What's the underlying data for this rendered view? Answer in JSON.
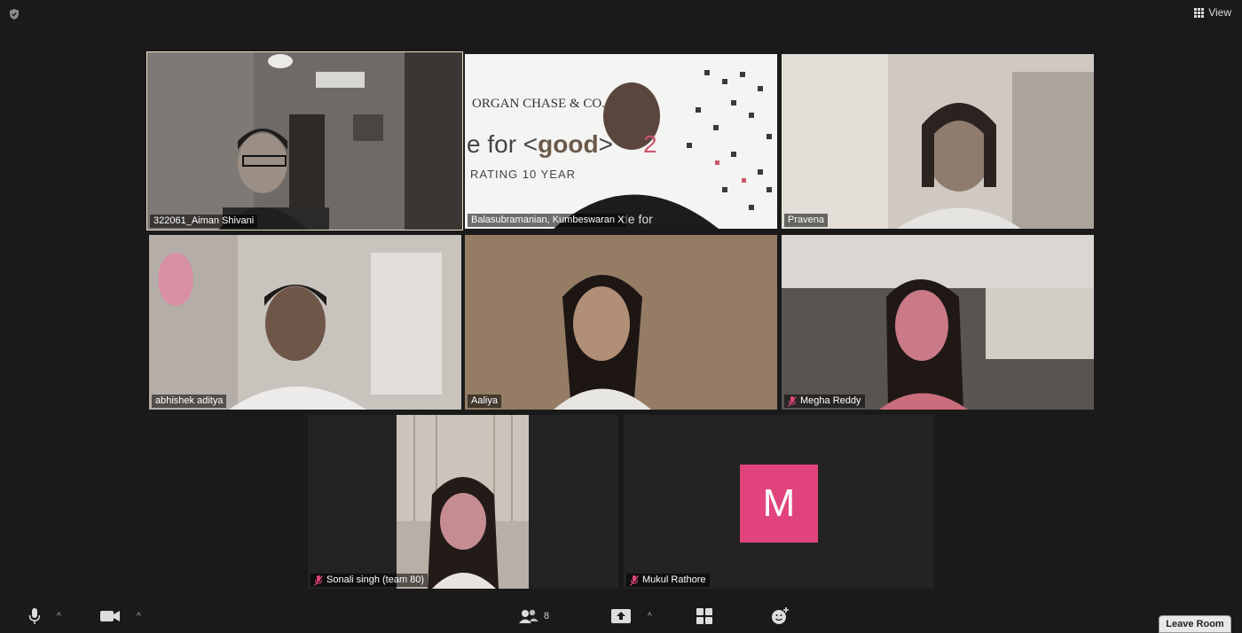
{
  "top": {
    "view_label": "View"
  },
  "participants": [
    {
      "name": "322061_Aiman Shivani",
      "muted": false,
      "active": true
    },
    {
      "name": "Balasubramanian, Kumbeswaran X",
      "muted": false,
      "active": false
    },
    {
      "name": "Pravena",
      "muted": false,
      "active": false
    },
    {
      "name": "abhishek aditya",
      "muted": false,
      "active": false
    },
    {
      "name": "Aaliya",
      "muted": false,
      "active": false
    },
    {
      "name": "Megha Reddy",
      "muted": true,
      "active": false
    },
    {
      "name": "Sonali singh (team 80)",
      "muted": true,
      "active": false
    },
    {
      "name": "Mukul Rathore",
      "muted": true,
      "active": false,
      "avatar_letter": "M"
    }
  ],
  "banner": {
    "company": "ORGAN CHASE & CO.",
    "line1_prefix": "e for <",
    "line1_bold": "good",
    "line1_suffix": ">",
    "line1_tail": "2",
    "line2": "RATING 10 YEAR",
    "shirt_text": "de for"
  },
  "toolbar": {
    "participants_count": "8",
    "leave_label": "Leave Room"
  },
  "colors": {
    "background": "#1a1a1a",
    "avatar": "#e1447c",
    "mute": "#e0457b"
  }
}
